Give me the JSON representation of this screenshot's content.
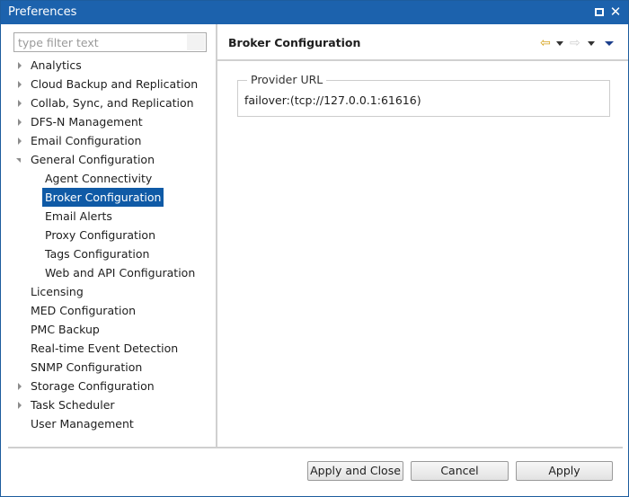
{
  "window": {
    "title": "Preferences"
  },
  "filter": {
    "placeholder": "type filter text"
  },
  "tree": [
    {
      "label": "Analytics",
      "expander": "collapsed"
    },
    {
      "label": "Cloud Backup and Replication",
      "expander": "collapsed"
    },
    {
      "label": "Collab, Sync, and Replication",
      "expander": "collapsed"
    },
    {
      "label": "DFS-N Management",
      "expander": "collapsed"
    },
    {
      "label": "Email Configuration",
      "expander": "collapsed"
    },
    {
      "label": "General Configuration",
      "expander": "expanded"
    },
    {
      "label": "Agent Connectivity",
      "child": true
    },
    {
      "label": "Broker Configuration",
      "child": true,
      "selected": true
    },
    {
      "label": "Email Alerts",
      "child": true
    },
    {
      "label": "Proxy Configuration",
      "child": true
    },
    {
      "label": "Tags Configuration",
      "child": true
    },
    {
      "label": "Web and API Configuration",
      "child": true
    },
    {
      "label": "Licensing"
    },
    {
      "label": "MED Configuration"
    },
    {
      "label": "PMC Backup"
    },
    {
      "label": "Real-time Event Detection"
    },
    {
      "label": "SNMP Configuration"
    },
    {
      "label": "Storage Configuration",
      "expander": "collapsed"
    },
    {
      "label": "Task Scheduler",
      "expander": "collapsed"
    },
    {
      "label": "User Management"
    }
  ],
  "page": {
    "title": "Broker Configuration",
    "group_label": "Provider URL",
    "provider_url": "failover:(tcp://127.0.0.1:61616)"
  },
  "buttons": {
    "apply_and_close": "Apply and Close",
    "cancel": "Cancel",
    "apply": "Apply"
  },
  "icons": {
    "back": "back-arrow-icon",
    "forward": "forward-arrow-icon",
    "view_menu": "view-menu-icon"
  },
  "colors": {
    "titlebar": "#1c62ad",
    "selection": "#0f5aa6"
  }
}
